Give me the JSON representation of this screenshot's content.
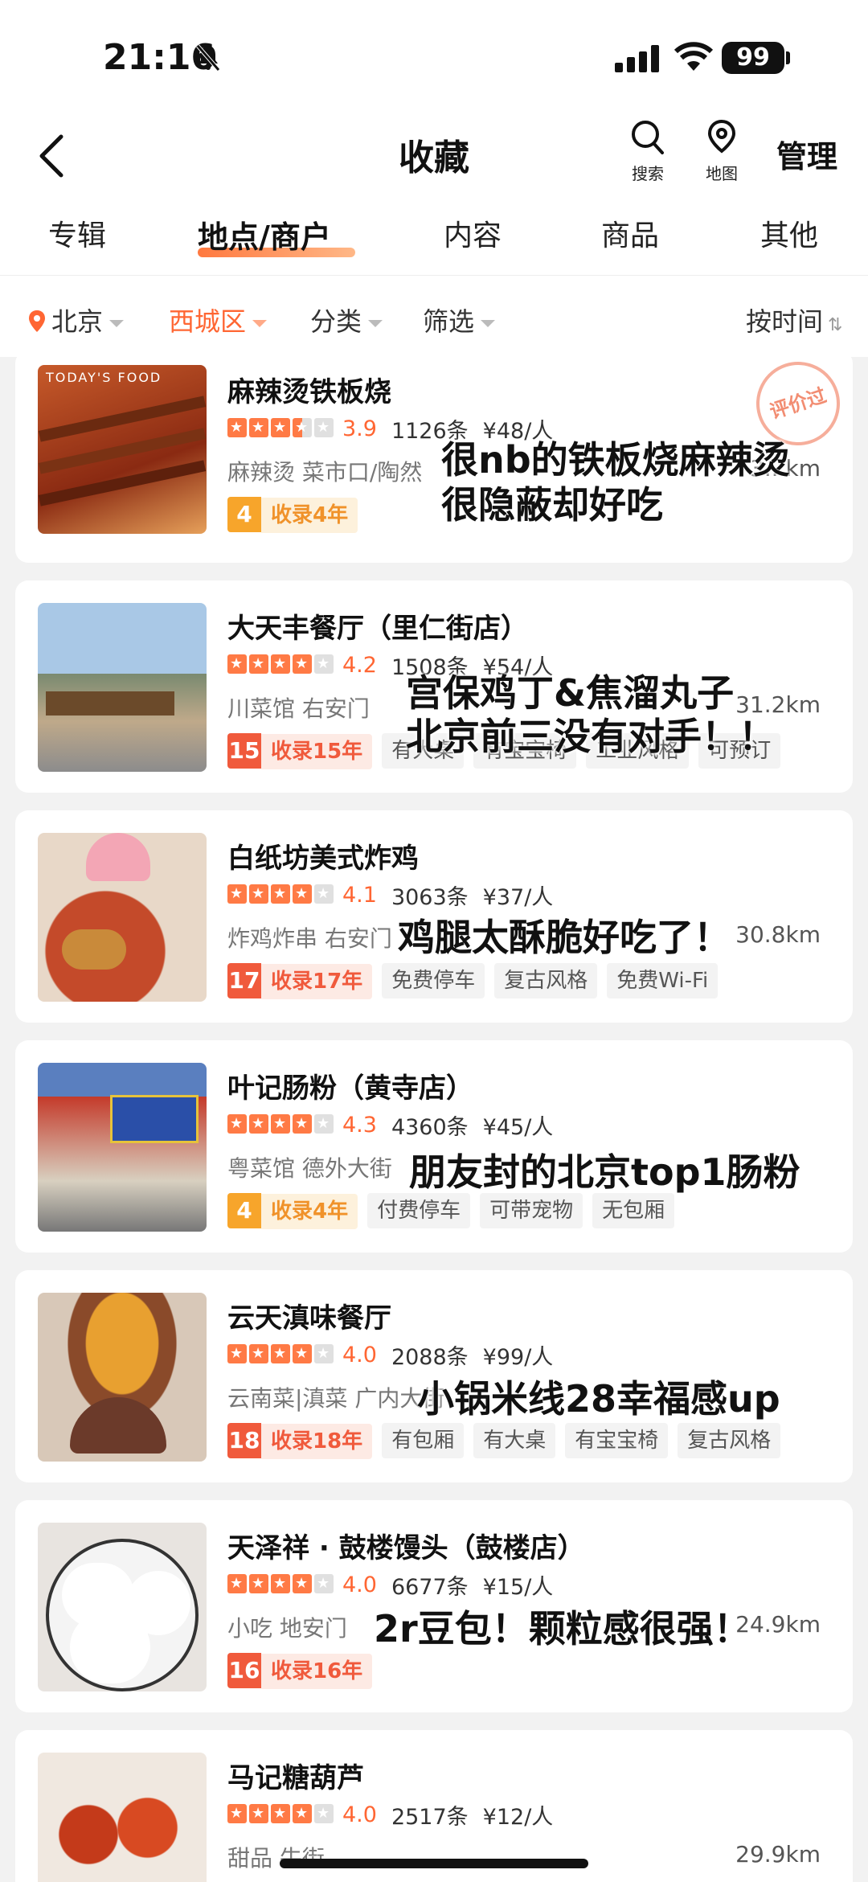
{
  "status": {
    "time": "21:16",
    "battery": "99"
  },
  "nav": {
    "title": "收藏",
    "search_label": "搜索",
    "map_label": "地图",
    "manage_label": "管理"
  },
  "tabs": [
    "专辑",
    "地点/商户",
    "内容",
    "商品",
    "其他"
  ],
  "active_tab": "地点/商户",
  "filters": {
    "city": "北京",
    "district": "西城区",
    "category": "分类",
    "filter": "筛选",
    "sort": "按时间"
  },
  "items": [
    {
      "name": "麻辣烫铁板烧",
      "rating": 3.9,
      "stars": 3.5,
      "reviews": "1126条",
      "price": "¥48/人",
      "category": "麻辣烫 菜市口/陶然",
      "distance": "3...km",
      "badge_num": "4",
      "badge_text": "收录4年",
      "badge_color": "yellow",
      "tags": [],
      "stamp": "评价过",
      "thumb_label": "TODAY'S FOOD",
      "note_lines": [
        "很nb的铁板烧麻辣烫",
        "很隐蔽却好吃"
      ]
    },
    {
      "name": "大天丰餐厅（里仁街店）",
      "rating": 4.2,
      "stars": 4,
      "reviews": "1508条",
      "price": "¥54/人",
      "category": "川菜馆 右安门",
      "distance": "31.2km",
      "badge_num": "15",
      "badge_text": "收录15年",
      "badge_color": "red",
      "tags": [
        "有大桌",
        "有宝宝椅",
        "工业风格",
        "可预订"
      ],
      "note_lines": [
        "宫保鸡丁&焦溜丸子",
        "北京前三没有对手！！"
      ]
    },
    {
      "name": "白纸坊美式炸鸡",
      "rating": 4.1,
      "stars": 4,
      "reviews": "3063条",
      "price": "¥37/人",
      "category": "炸鸡炸串 右安门",
      "distance": "30.8km",
      "badge_num": "17",
      "badge_text": "收录17年",
      "badge_color": "red",
      "tags": [
        "免费停车",
        "复古风格",
        "免费Wi-Fi"
      ],
      "note_lines": [
        "鸡腿太酥脆好吃了！"
      ]
    },
    {
      "name": "叶记肠粉（黄寺店）",
      "rating": 4.3,
      "stars": 4,
      "reviews": "4360条",
      "price": "¥45/人",
      "category": "粤菜馆 德外大街",
      "distance": "",
      "badge_num": "4",
      "badge_text": "收录4年",
      "badge_color": "yellow",
      "tags": [
        "付费停车",
        "可带宠物",
        "无包厢"
      ],
      "note_lines": [
        "朋友封的北京top1肠粉"
      ]
    },
    {
      "name": "云天滇味餐厅",
      "rating": 4.0,
      "stars": 4,
      "reviews": "2088条",
      "price": "¥99/人",
      "category": "云南菜|滇菜 广内大街",
      "distance": "",
      "badge_num": "18",
      "badge_text": "收录18年",
      "badge_color": "red",
      "tags": [
        "有包厢",
        "有大桌",
        "有宝宝椅",
        "复古风格"
      ],
      "note_lines": [
        "小锅米线28幸福感up"
      ]
    },
    {
      "name": "天泽祥 · 鼓楼馒头（鼓楼店）",
      "rating": 4.0,
      "stars": 4,
      "reviews": "6677条",
      "price": "¥15/人",
      "category": "小吃 地安门",
      "distance": "24.9km",
      "badge_num": "16",
      "badge_text": "收录16年",
      "badge_color": "red",
      "tags": [],
      "note_lines": [
        "2r豆包！颗粒感很强！"
      ]
    },
    {
      "name": "马记糖葫芦",
      "rating": 4.0,
      "stars": 4,
      "reviews": "2517条",
      "price": "¥12/人",
      "category": "甜品 牛街",
      "distance": "29.9km",
      "badge_num": "",
      "badge_text": "",
      "badge_color": "red",
      "tags": [],
      "note_lines": []
    }
  ]
}
